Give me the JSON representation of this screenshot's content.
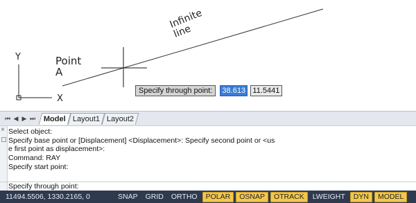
{
  "drawing": {
    "point_label_line1": "Point",
    "point_label_line2": "A",
    "ray_label_line1": "Infinite",
    "ray_label_line2": "line",
    "ucs_x_label": "X",
    "ucs_y_label": "Y"
  },
  "dynamic_input": {
    "prompt": "Specify through point:",
    "value1": "38.613",
    "value2": "11.5441"
  },
  "tabs": {
    "nav_first": "⏮",
    "nav_prev": "◀",
    "nav_next": "▶",
    "nav_last": "⏭",
    "items": [
      "Model",
      "Layout1",
      "Layout2"
    ]
  },
  "command_line": {
    "history": [
      "Select object:",
      "Specify base point or [Displacement] <Displacement>: Specify second point or <us",
      "e first point as displacement>:",
      "Command: RAY",
      "Specify start point:"
    ],
    "input": "Specify through point:",
    "close_icon": "×"
  },
  "status_bar": {
    "coordinates": "11494.5506, 1330.2165, 0",
    "toggles": [
      {
        "label": "SNAP",
        "on": false
      },
      {
        "label": "GRID",
        "on": false
      },
      {
        "label": "ORTHO",
        "on": false
      },
      {
        "label": "POLAR",
        "on": true
      },
      {
        "label": "OSNAP",
        "on": true
      },
      {
        "label": "OTRACK",
        "on": true
      },
      {
        "label": "LWEIGHT",
        "on": false
      },
      {
        "label": "DYN",
        "on": true
      },
      {
        "label": "MODEL",
        "on": true
      }
    ]
  },
  "colors": {
    "status_bg": "#2f3a4e",
    "toggle_on": "#f4c649",
    "dyn_active": "#3a7bd5"
  }
}
